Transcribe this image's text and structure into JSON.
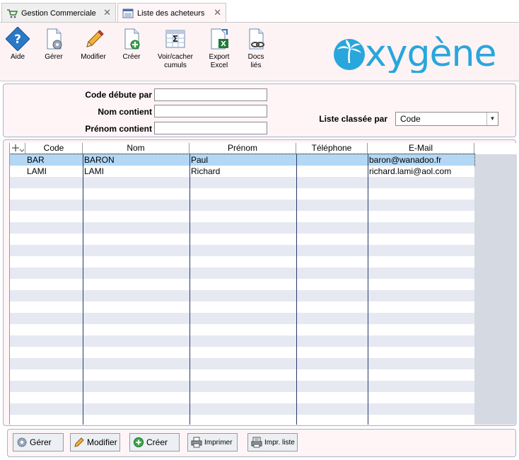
{
  "tabs": [
    {
      "label": "Gestion Commerciale",
      "icon": "cart-icon"
    },
    {
      "label": "Liste des acheteurs",
      "icon": "list-window-icon"
    }
  ],
  "toolbar": {
    "aide": "Aide",
    "gerer": "Gérer",
    "modifier": "Modifier",
    "creer": "Créer",
    "cumuls_1": "Voir/cacher",
    "cumuls_2": "cumuls",
    "export_1": "Export",
    "export_2": "Excel",
    "docs_1": "Docs",
    "docs_2": "liés"
  },
  "logo": {
    "text": "xygène"
  },
  "filter": {
    "code_label": "Code débute par",
    "code_value": "",
    "nom_label": "Nom contient",
    "nom_value": "",
    "prenom_label": "Prénom contient",
    "prenom_value": "",
    "sort_label": "Liste classée par",
    "sort_value": "Code"
  },
  "grid": {
    "columns": [
      "Code",
      "Nom",
      "Prénom",
      "Téléphone",
      "E-Mail"
    ],
    "rows": [
      {
        "code": "BAR",
        "nom": "BARON",
        "prenom": "Paul",
        "telephone": "",
        "email": "baron@wanadoo.fr"
      },
      {
        "code": "LAMI",
        "nom": "LAMI",
        "prenom": "Richard",
        "telephone": "",
        "email": "richard.lami@aol.com"
      }
    ]
  },
  "bottom": {
    "gerer": "Gérer",
    "modifier": "Modifier",
    "creer": "Créer",
    "imprimer": "Imprimer",
    "impr_liste": "Impr. liste"
  },
  "colors": {
    "brand": "#29a6dc",
    "selected_row": "#b3d7f5",
    "row_alt": "#e6e9f2",
    "panel_bg": "#fff5f7"
  }
}
